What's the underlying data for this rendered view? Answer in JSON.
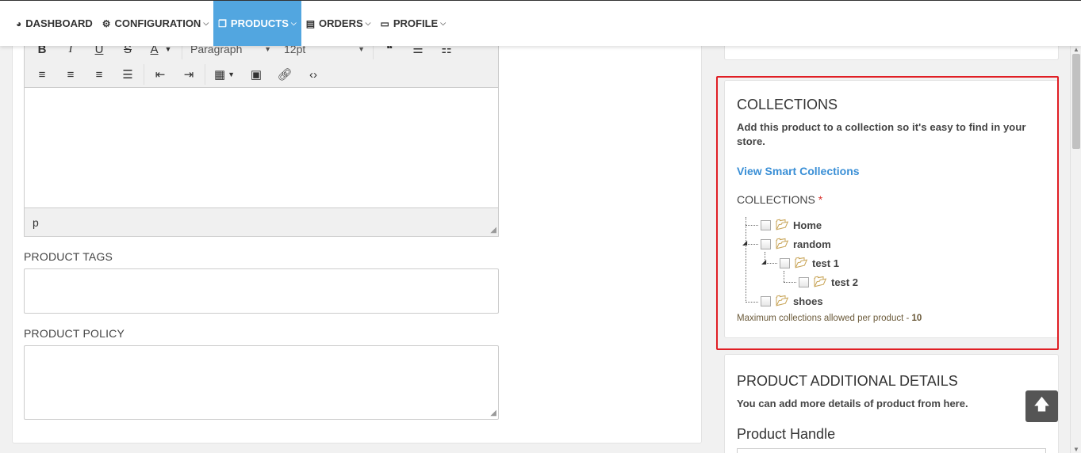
{
  "nav": {
    "items": [
      {
        "label": "DASHBOARD",
        "icon": "dashboard-icon",
        "glyph": "◕",
        "active": false,
        "has_caret": false
      },
      {
        "label": "CONFIGURATION",
        "icon": "gear-icon",
        "glyph": "⚙",
        "active": false,
        "has_caret": true
      },
      {
        "label": "PRODUCTS",
        "icon": "copy-icon",
        "glyph": "❐",
        "active": true,
        "has_caret": true
      },
      {
        "label": "ORDERS",
        "icon": "clipboard-icon",
        "glyph": "▤",
        "active": false,
        "has_caret": true
      },
      {
        "label": "PROFILE",
        "icon": "id-card-icon",
        "glyph": "▭",
        "active": false,
        "has_caret": true
      }
    ]
  },
  "editor": {
    "format_select": "Paragraph",
    "size_select": "12pt",
    "status_path": "p"
  },
  "fields": {
    "tags_label": "PRODUCT TAGS",
    "policy_label": "PRODUCT POLICY"
  },
  "collections": {
    "title": "COLLECTIONS",
    "description": "Add this product to a collection so it's easy to find in your store.",
    "link": "View Smart Collections",
    "label": "COLLECTIONS",
    "required_mark": "*",
    "tree": [
      {
        "label": "Home"
      },
      {
        "label": "random"
      },
      {
        "label": "test 1"
      },
      {
        "label": "test 2"
      },
      {
        "label": "shoes"
      }
    ],
    "note_prefix": "Maximum collections allowed per product - ",
    "note_value": "10"
  },
  "details": {
    "title": "PRODUCT ADDITIONAL DETAILS",
    "description": "You can add more details of product from here.",
    "handle_label": "Product Handle"
  },
  "colors": {
    "accent": "#52a6e0",
    "highlight": "#e01e24",
    "link": "#3a8fd6"
  }
}
